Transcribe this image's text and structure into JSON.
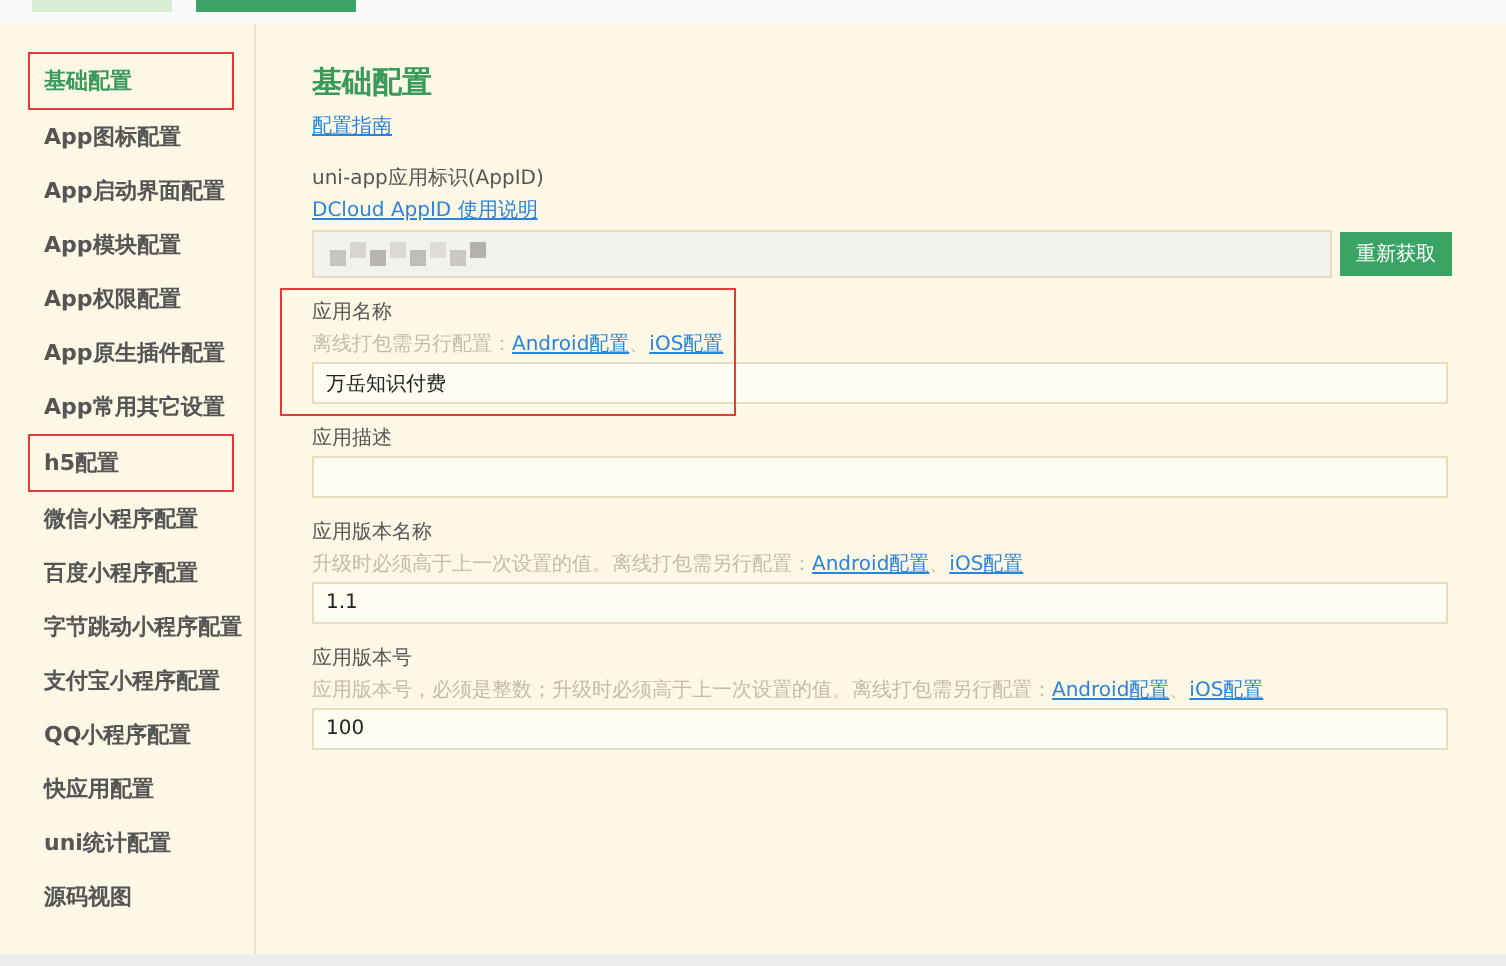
{
  "sidebar": {
    "items": [
      {
        "label": "基础配置",
        "selected": true,
        "highlighted": true
      },
      {
        "label": "App图标配置",
        "selected": false,
        "highlighted": false
      },
      {
        "label": "App启动界面配置",
        "selected": false,
        "highlighted": false
      },
      {
        "label": "App模块配置",
        "selected": false,
        "highlighted": false
      },
      {
        "label": "App权限配置",
        "selected": false,
        "highlighted": false
      },
      {
        "label": "App原生插件配置",
        "selected": false,
        "highlighted": false
      },
      {
        "label": "App常用其它设置",
        "selected": false,
        "highlighted": false
      },
      {
        "label": "h5配置",
        "selected": false,
        "highlighted": true
      },
      {
        "label": "微信小程序配置",
        "selected": false,
        "highlighted": false
      },
      {
        "label": "百度小程序配置",
        "selected": false,
        "highlighted": false
      },
      {
        "label": "字节跳动小程序配置",
        "selected": false,
        "highlighted": false
      },
      {
        "label": "支付宝小程序配置",
        "selected": false,
        "highlighted": false
      },
      {
        "label": "QQ小程序配置",
        "selected": false,
        "highlighted": false
      },
      {
        "label": "快应用配置",
        "selected": false,
        "highlighted": false
      },
      {
        "label": "uni统计配置",
        "selected": false,
        "highlighted": false
      },
      {
        "label": "源码视图",
        "selected": false,
        "highlighted": false
      }
    ]
  },
  "content": {
    "title": "基础配置",
    "guide_link": "配置指南",
    "fields": [
      {
        "kind": "appid",
        "label": "uni-app应用标识(AppID)",
        "help_link": "DCloud AppID 使用说明",
        "button": "重新获取"
      },
      {
        "kind": "text",
        "label": "应用名称",
        "hint": [
          {
            "kind": "text",
            "text": "离线打包需另行配置："
          },
          {
            "kind": "link",
            "text": "Android配置"
          },
          {
            "kind": "text",
            "text": "、"
          },
          {
            "kind": "link",
            "text": "iOS配置"
          }
        ],
        "value": "万岳知识付费",
        "highlighted": true
      },
      {
        "kind": "text",
        "label": "应用描述"
      },
      {
        "kind": "text",
        "label": "应用版本名称",
        "hint": [
          {
            "kind": "text",
            "text": "升级时必须高于上一次设置的值。离线打包需另行配置："
          },
          {
            "kind": "link",
            "text": "Android配置"
          },
          {
            "kind": "text",
            "text": "、"
          },
          {
            "kind": "link",
            "text": "iOS配置"
          }
        ],
        "value": "1.1"
      },
      {
        "kind": "text",
        "label": "应用版本号",
        "hint": [
          {
            "kind": "text",
            "text": "应用版本号，必须是整数；升级时必须高于上一次设置的值。离线打包需另行配置："
          },
          {
            "kind": "link",
            "text": "Android配置"
          },
          {
            "kind": "text",
            "text": "、"
          },
          {
            "kind": "link",
            "text": "iOS配置"
          }
        ],
        "value": "100"
      }
    ]
  }
}
